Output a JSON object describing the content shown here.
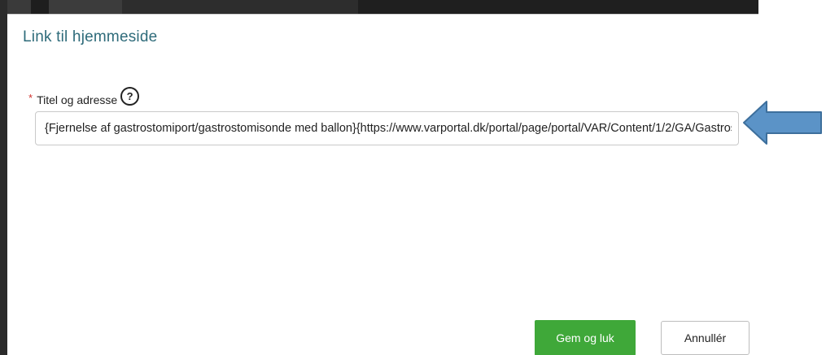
{
  "dialog": {
    "title": "Link til hjemmeside"
  },
  "field": {
    "required_marker": "*",
    "label": "Titel og adresse",
    "help_glyph": "?",
    "value": "{Fjernelse af gastrostomiport/gastrostomisonde med ballon}{https://www.varportal.dk/portal/page/portal/VAR/Content/1/2/GA/Gastrostomiport/Fjernelse_af_gastrostomiport_gastrostomisonde_med_ballon}"
  },
  "buttons": {
    "save_label": "Gem og luk",
    "cancel_label": "Annullér"
  },
  "colors": {
    "title": "#2e6b7a",
    "required": "#d0322e",
    "save_button": "#3fa839",
    "arrow_fill": "#5b93c7",
    "arrow_stroke": "#3d6f9c"
  },
  "icons": {
    "help": "help-circle-icon",
    "annotation": "left-arrow-icon"
  }
}
